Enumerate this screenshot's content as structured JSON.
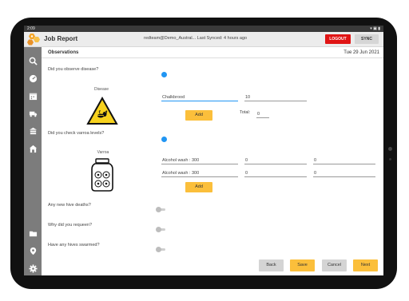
{
  "status_bar": {
    "time": "2:09",
    "right": "▾ ▣ ▮"
  },
  "header": {
    "app_title": "Job Report",
    "user_info": "redteam@Demo_Austral...   Last Synced: 4 hours ago",
    "logout_label": "LOGOUT",
    "sync_label": "SYNC"
  },
  "sidebar": {
    "items": [
      {
        "icon": "search-icon"
      },
      {
        "icon": "dashboard-icon"
      },
      {
        "icon": "calendar-icon"
      },
      {
        "icon": "truck-icon"
      },
      {
        "icon": "hive-icon"
      },
      {
        "icon": "apiary-icon"
      },
      {
        "icon": "folder-icon"
      },
      {
        "icon": "location-icon"
      },
      {
        "icon": "gear-icon"
      }
    ]
  },
  "section": {
    "title": "Observations",
    "date": "Tue 29 Jun 2021"
  },
  "disease": {
    "question": "Did you observe disease?",
    "image_label": "Disease",
    "name_value": "Chalkbrood",
    "count_value": "10",
    "add_label": "Add",
    "total_label": "Total:",
    "total_value": "0"
  },
  "varroa": {
    "question": "Did you check varroa levels?",
    "image_label": "Varroa",
    "rows": [
      {
        "method": "Alcohol wash : 300",
        "a": "0",
        "b": "0"
      },
      {
        "method": "Alcohol wash : 300",
        "a": "0",
        "b": "0"
      }
    ],
    "add_label": "Add"
  },
  "questions": {
    "hive_deaths": "Any new hive deaths?",
    "requeen": "Why did you requeen?",
    "swarmed": "Have any hives swarmed?"
  },
  "footer": {
    "back": "Back",
    "save": "Save",
    "cancel": "Cancel",
    "next": "Next"
  },
  "colors": {
    "accent": "#2196f3",
    "logout": "#e01414",
    "primary_button": "#fbbf3b",
    "sidebar": "#7c7c7c"
  }
}
